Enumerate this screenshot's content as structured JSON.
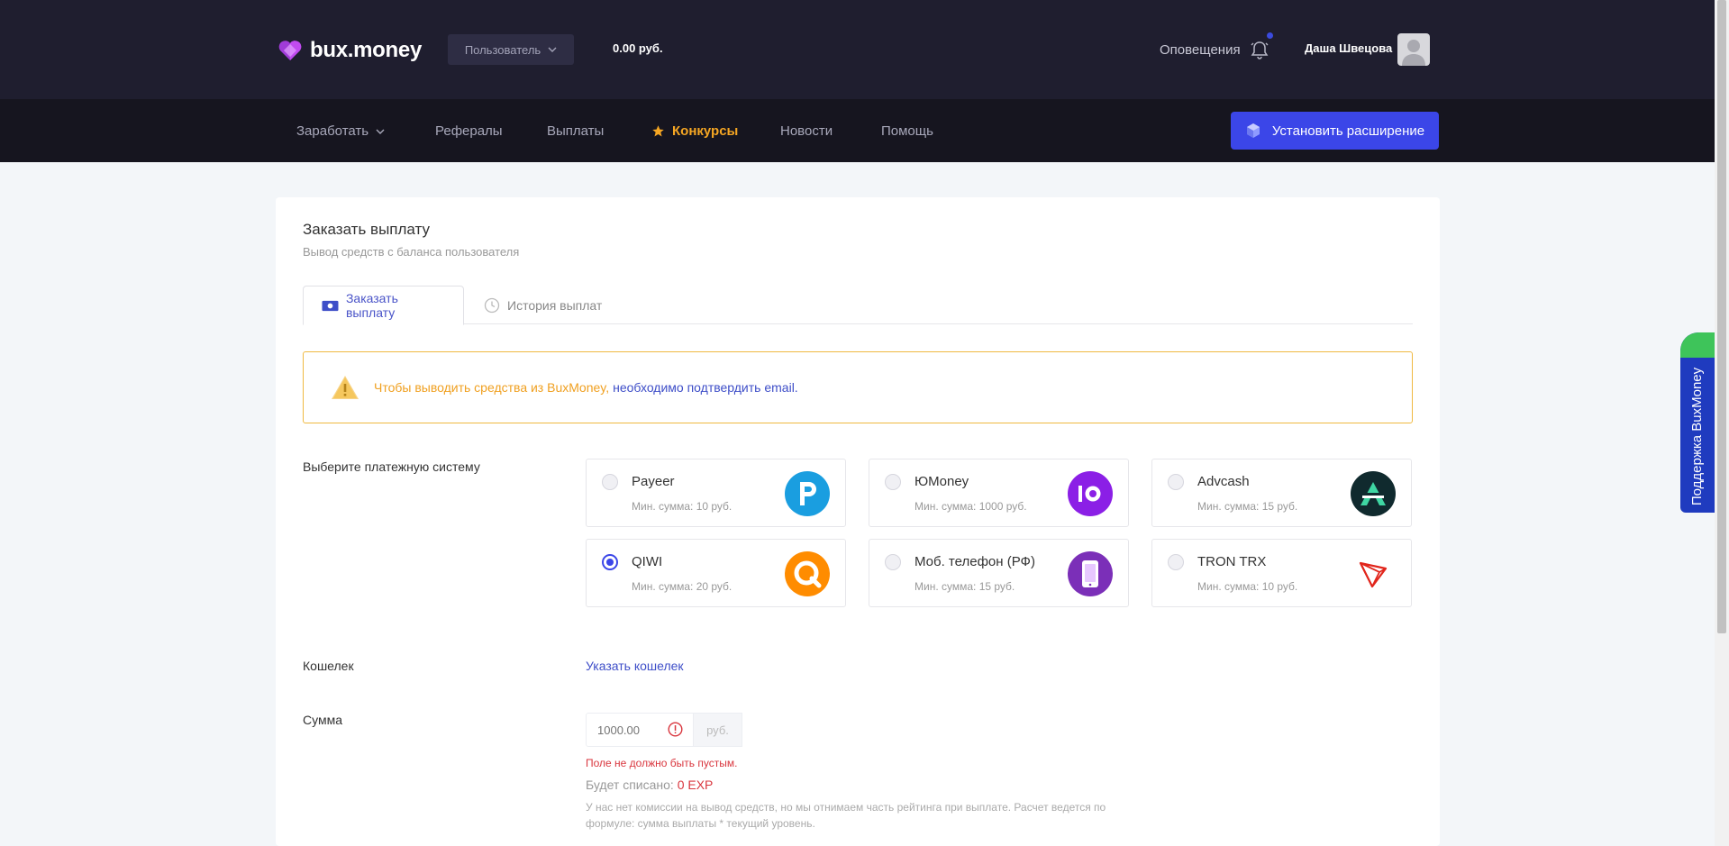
{
  "header": {
    "logo_text": "bux.money",
    "user_dropdown_label": "Пользователь",
    "balance": "0.00 руб.",
    "notifications_label": "Оповещения",
    "username": "Даша Швецова"
  },
  "nav": {
    "items": [
      {
        "label": "Заработать"
      },
      {
        "label": "Рефералы"
      },
      {
        "label": "Выплаты"
      },
      {
        "label": "Конкурсы"
      },
      {
        "label": "Новости"
      },
      {
        "label": "Помощь"
      }
    ],
    "install_label": "Установить расширение"
  },
  "page": {
    "title": "Заказать выплату",
    "subtitle": "Вывод средств с баланса пользователя",
    "tabs": [
      {
        "label": "Заказать выплату"
      },
      {
        "label": "История выплат"
      }
    ],
    "alert_text": "Чтобы выводить средства из BuxMoney,",
    "alert_link": "необходимо подтвердить email."
  },
  "payment": {
    "label": "Выберите платежную систему",
    "selected": "QIWI",
    "options": [
      {
        "name": "Payeer",
        "min": "Мин. сумма: 10 руб."
      },
      {
        "name": "ЮMoney",
        "min": "Мин. сумма: 1000 руб."
      },
      {
        "name": "Advcash",
        "min": "Мин. сумма: 15 руб."
      },
      {
        "name": "QIWI",
        "min": "Мин. сумма: 20 руб."
      },
      {
        "name": "Моб. телефон (РФ)",
        "min": "Мин. сумма: 15 руб."
      },
      {
        "name": "TRON TRX",
        "min": "Мин. сумма: 10 руб."
      }
    ]
  },
  "wallet": {
    "label": "Кошелек",
    "link": "Указать кошелек"
  },
  "sum": {
    "label": "Сумма",
    "placeholder": "1000.00",
    "unit": "руб.",
    "error": "Поле не должно быть пустым.",
    "deduct_label": "Будет списано:",
    "deduct_value": "0 EXP",
    "note": "У нас нет комиссии на вывод средств, но мы отнимаем часть рейтинга при выплате. Расчет ведется по формуле: сумма выплаты * текущий уровень."
  },
  "support_label": "Поддержка BuxMoney",
  "colors": {
    "topbar": "#1f1e2f",
    "navbar": "#16151f",
    "accent": "#3b46e8",
    "active_nav": "#f5a623",
    "warning": "#f0b941",
    "error": "#d9363e"
  }
}
